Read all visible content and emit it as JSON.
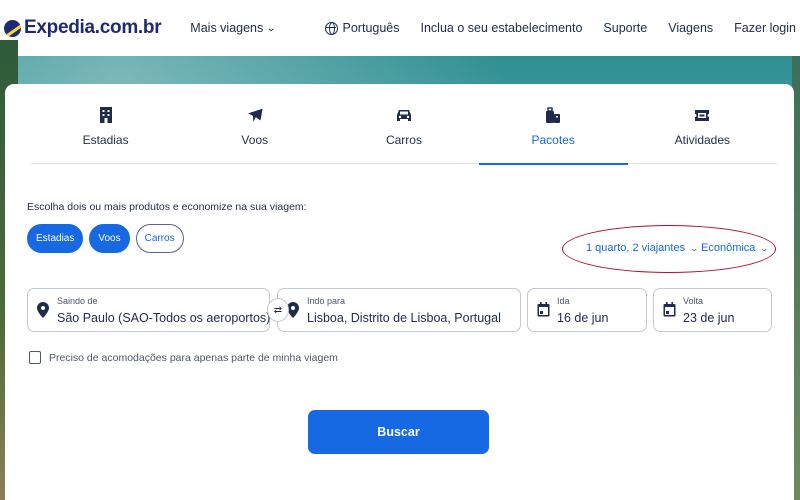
{
  "header": {
    "logo_text": "Expedia.com.br",
    "mais_viagens": "Mais viagens",
    "language": "Português",
    "list_property": "Inclua o seu estabelecimento",
    "support": "Suporte",
    "trips": "Viagens",
    "login": "Fazer login"
  },
  "tabs": [
    {
      "label": "Estadias",
      "icon": "hotel-icon"
    },
    {
      "label": "Voos",
      "icon": "plane-icon"
    },
    {
      "label": "Carros",
      "icon": "car-icon"
    },
    {
      "label": "Pacotes",
      "icon": "package-icon",
      "active": true
    },
    {
      "label": "Atividades",
      "icon": "ticket-icon"
    }
  ],
  "package": {
    "intro": "Escolha dois ou mais produtos e economize na sua viagem:",
    "chips": [
      {
        "label": "Estadias",
        "selected": true
      },
      {
        "label": "Voos",
        "selected": true
      },
      {
        "label": "Carros",
        "selected": false
      }
    ],
    "travelers": "1 quarto, 2 viajantes",
    "cabin_class": "Econômica"
  },
  "fields": {
    "origin": {
      "label": "Saindo de",
      "value": "São Paulo (SAO-Todos os aeroportos)"
    },
    "destination": {
      "label": "Indo para",
      "value": "Lisboa, Distrito de Lisboa, Portugal"
    },
    "departure": {
      "label": "Ida",
      "value": "16 de jun"
    },
    "return": {
      "label": "Volta",
      "value": "23 de jun"
    }
  },
  "partial_stay": "Preciso de acomodações para apenas parte de minha viagem",
  "search_button": "Buscar",
  "colors": {
    "accent": "#1668e3",
    "text": "#1f2b4d",
    "annotation": "#b1122a"
  }
}
